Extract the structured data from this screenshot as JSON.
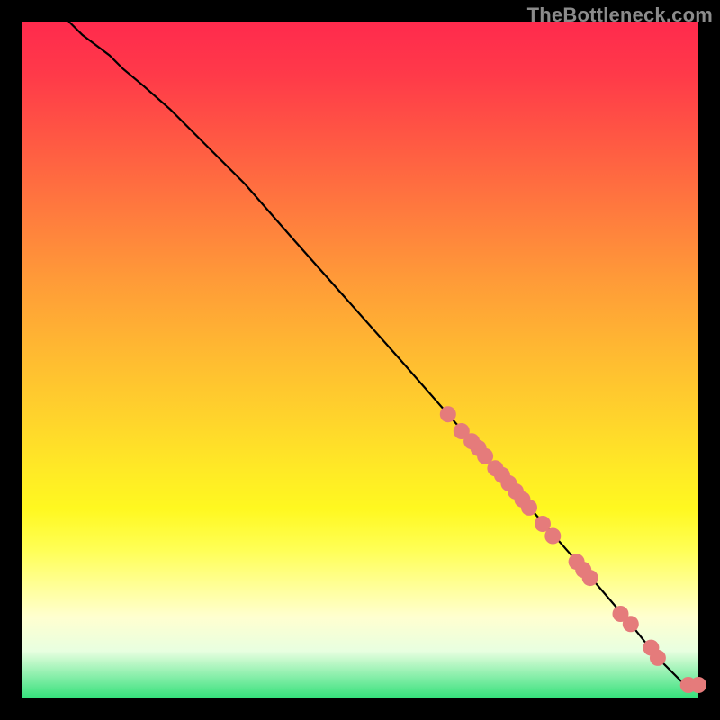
{
  "attribution": "TheBottleneck.com",
  "chart_data": {
    "type": "line",
    "title": "",
    "xlabel": "",
    "ylabel": "",
    "xlim": [
      0,
      100
    ],
    "ylim": [
      0,
      100
    ],
    "grid": false,
    "legend": false,
    "background": "rainbow-gradient",
    "series": [
      {
        "name": "curve",
        "color": "#000000",
        "x": [
          7,
          9,
          11,
          13,
          15,
          18,
          22,
          27,
          33,
          40,
          48,
          56,
          63,
          70,
          77,
          84,
          90,
          94,
          97,
          98,
          99,
          100
        ],
        "values": [
          100,
          98,
          96.5,
          95,
          93,
          90.5,
          87,
          82,
          76,
          68,
          59,
          50,
          42,
          34,
          26,
          18,
          11,
          6,
          3,
          2,
          2,
          2
        ]
      }
    ],
    "points": {
      "name": "cluster",
      "color": "#e57b7b",
      "radius": 9,
      "x": [
        63,
        65,
        66.5,
        67.5,
        68.5,
        70,
        71,
        72,
        73,
        74,
        75,
        77,
        78.5,
        82,
        83,
        84,
        88.5,
        90,
        93,
        94,
        98.5,
        100
      ],
      "values": [
        42,
        39.5,
        38,
        37,
        35.8,
        34,
        33,
        31.8,
        30.6,
        29.4,
        28.2,
        25.8,
        24,
        20.2,
        19,
        17.8,
        12.5,
        11,
        7.5,
        6,
        2,
        2
      ]
    }
  }
}
